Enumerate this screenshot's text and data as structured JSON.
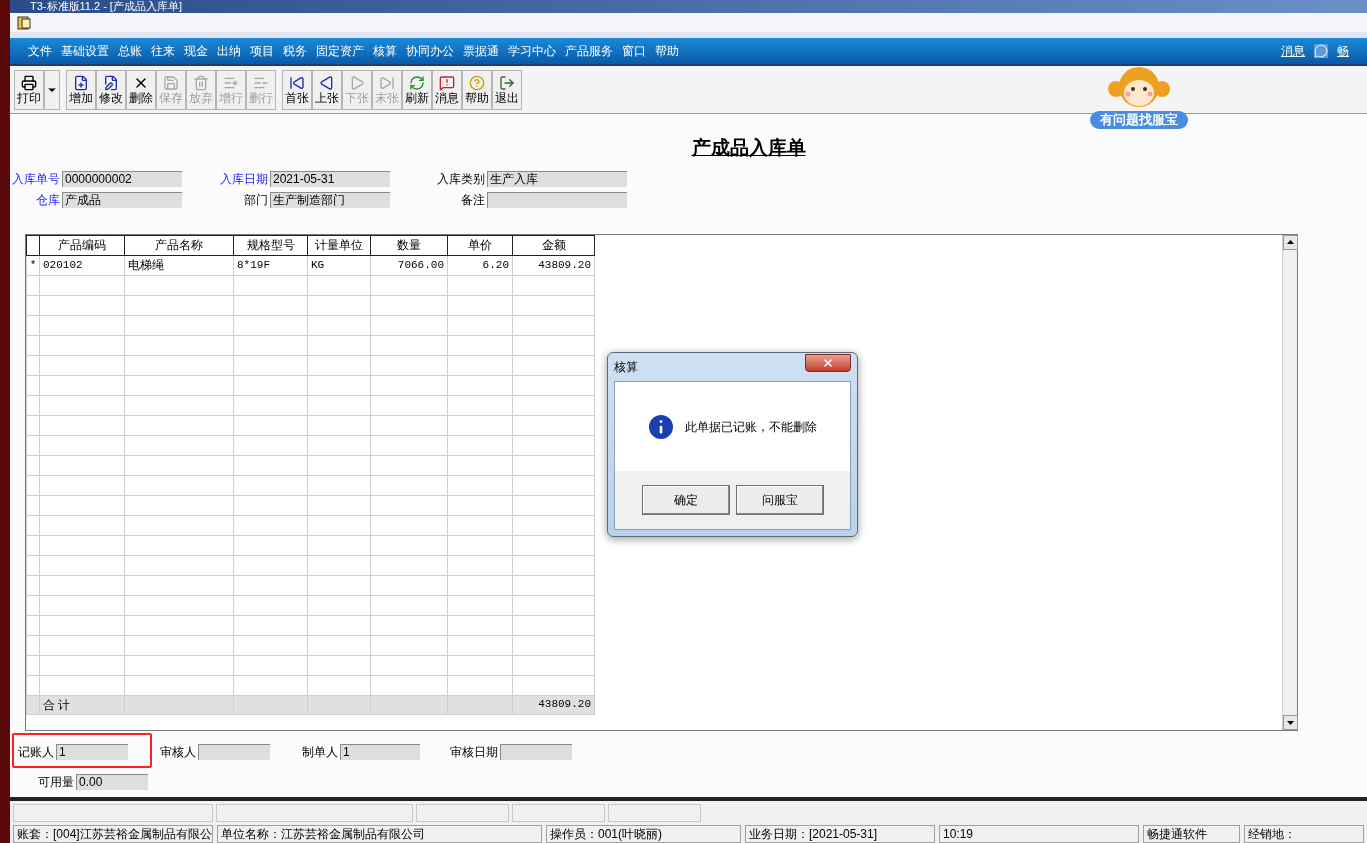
{
  "window": {
    "title": "T3-标准版11.2 - [产成品入库单]"
  },
  "menu_bar": {
    "items": [
      "文件",
      "基础设置",
      "总账",
      "往来",
      "现金",
      "出纳",
      "项目",
      "税务",
      "固定资产",
      "核算",
      "协同办公",
      "票据通",
      "学习中心",
      "产品服务",
      "窗口",
      "帮助"
    ],
    "messages": "消息",
    "brand": "畅"
  },
  "toolbar": [
    [
      {
        "label": "打印",
        "kind": "print",
        "disabled": false,
        "dropdown": true
      }
    ],
    [
      {
        "label": "增加",
        "kind": "add",
        "disabled": false
      },
      {
        "label": "修改",
        "kind": "edit",
        "disabled": false
      },
      {
        "label": "删除",
        "kind": "delete",
        "disabled": false
      },
      {
        "label": "保存",
        "kind": "save",
        "disabled": true
      },
      {
        "label": "放弃",
        "kind": "discard",
        "disabled": true
      },
      {
        "label": "增行",
        "kind": "addrow",
        "disabled": true
      },
      {
        "label": "删行",
        "kind": "delrow",
        "disabled": true
      }
    ],
    [
      {
        "label": "首张",
        "kind": "first",
        "disabled": false
      },
      {
        "label": "上张",
        "kind": "prev",
        "disabled": false
      },
      {
        "label": "下张",
        "kind": "next",
        "disabled": true
      },
      {
        "label": "末张",
        "kind": "last",
        "disabled": true
      },
      {
        "label": "刷新",
        "kind": "refresh",
        "disabled": false
      },
      {
        "label": "消息",
        "kind": "message",
        "disabled": false
      },
      {
        "label": "帮助",
        "kind": "help",
        "disabled": false
      },
      {
        "label": "退出",
        "kind": "exit",
        "disabled": false
      }
    ]
  ],
  "helper": {
    "label": "有问题找服宝"
  },
  "form": {
    "title": "产成品入库单",
    "header_rows": [
      [
        {
          "label": "入库单号",
          "value": "0000000002",
          "required": true
        },
        {
          "label": "入库日期",
          "value": "2021-05-31",
          "required": true
        },
        {
          "label": "入库类别",
          "value": "生产入库",
          "required": false
        }
      ],
      [
        {
          "label": "仓库",
          "value": "产成品",
          "required": true
        },
        {
          "label": "部门",
          "value": "生产制造部门",
          "required": false
        },
        {
          "label": "备注",
          "required": false
        }
      ]
    ],
    "footer_rows": [
      [
        {
          "label": "记账人",
          "value": "1",
          "highlighted": true
        },
        {
          "label": "审核人"
        },
        {
          "label": "制单人",
          "value": "1"
        },
        {
          "label": "审核日期"
        }
      ],
      [
        {
          "label": "可用量",
          "value": "0.00"
        }
      ]
    ]
  },
  "grid": {
    "columns": [
      "产品编码",
      "产品名称",
      "规格型号",
      "计量单位",
      "数量",
      "单价",
      "金额"
    ],
    "rows": [
      {
        "marker": "*",
        "cells": [
          "020102",
          "电梯绳",
          "8*19F",
          "KG",
          "7066.00",
          "6.20",
          "43809.20"
        ]
      }
    ],
    "total": {
      "label": "合 计",
      "amount": "43809.20"
    }
  },
  "dialog": {
    "title": "核算",
    "message": "此单据已记账，不能删除",
    "buttons": [
      "确定",
      "问服宝"
    ]
  },
  "status_bar": {
    "segments": [
      "账套：[004]江苏芸裕金属制品有限公",
      "单位名称：江苏芸裕金属制品有限公司",
      "操作员：001(叶晓丽)",
      "业务日期：[2021-05-31]",
      "10:19",
      "畅捷通软件",
      "经销地："
    ]
  }
}
